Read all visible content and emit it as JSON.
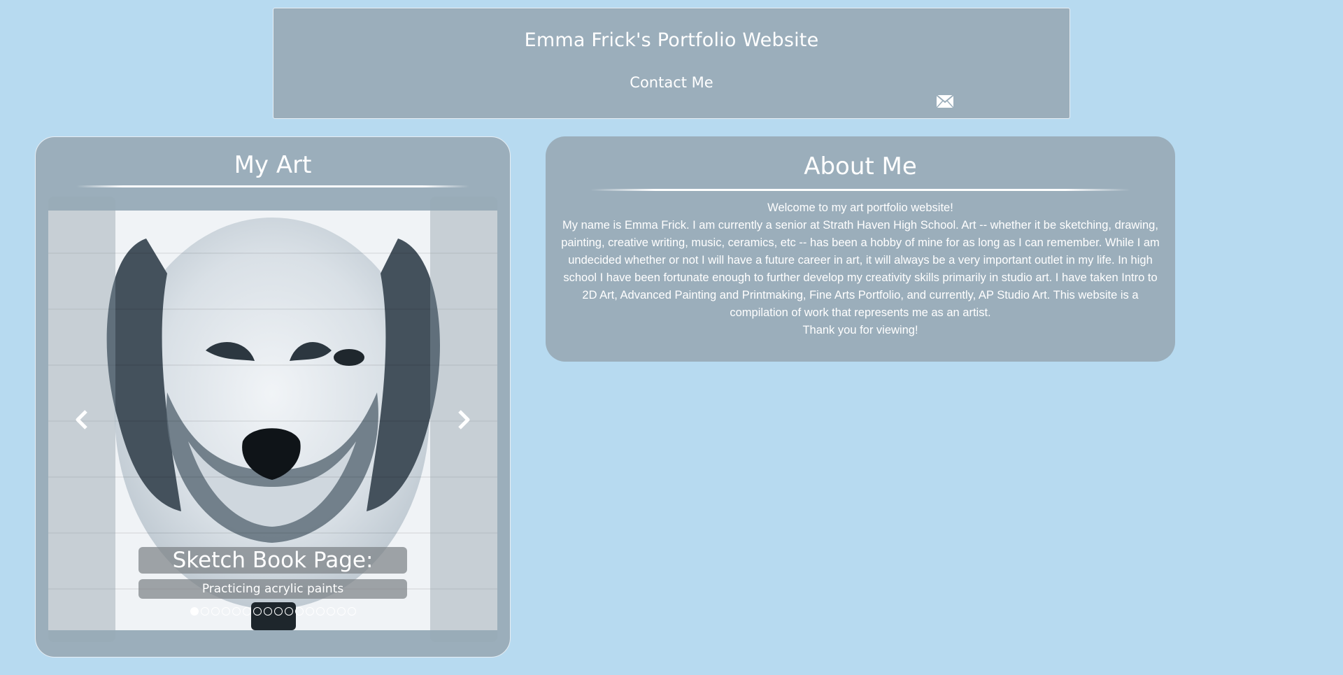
{
  "header": {
    "title": "Emma Frick's Portfolio Website",
    "contact_label": "Contact Me",
    "contact_icon": "envelope-icon"
  },
  "art": {
    "heading": "My Art",
    "slide": {
      "title": "Sketch Book Page:",
      "subtitle": "Practicing acrylic paints"
    },
    "slide_count": 16,
    "active_slide": 1,
    "prev_icon": "chevron-left-icon",
    "next_icon": "chevron-right-icon"
  },
  "about": {
    "heading": "About Me",
    "welcome": "Welcome to my art portfolio website!",
    "body": "My name is Emma Frick. I am currently a senior at Strath Haven High School. Art -- whether it be sketching, drawing, painting, creative writing, music, ceramics, etc -- has been a hobby of mine for as long as I can remember. While I am undecided whether or not I will have a future career in art, it will always be a very important outlet in my life. In high school I have been fortunate enough to further develop my creativity skills primarily in studio art. I have taken Intro to 2D Art, Advanced Painting and Printmaking, Fine Arts Portfolio, and currently, AP Studio Art. This website is a compilation of work that represents me as an artist.",
    "closing": "Thank you for viewing!"
  },
  "colors": {
    "page_background": "#b7daf0",
    "panel": "#9baebb",
    "text": "#ffffff"
  }
}
